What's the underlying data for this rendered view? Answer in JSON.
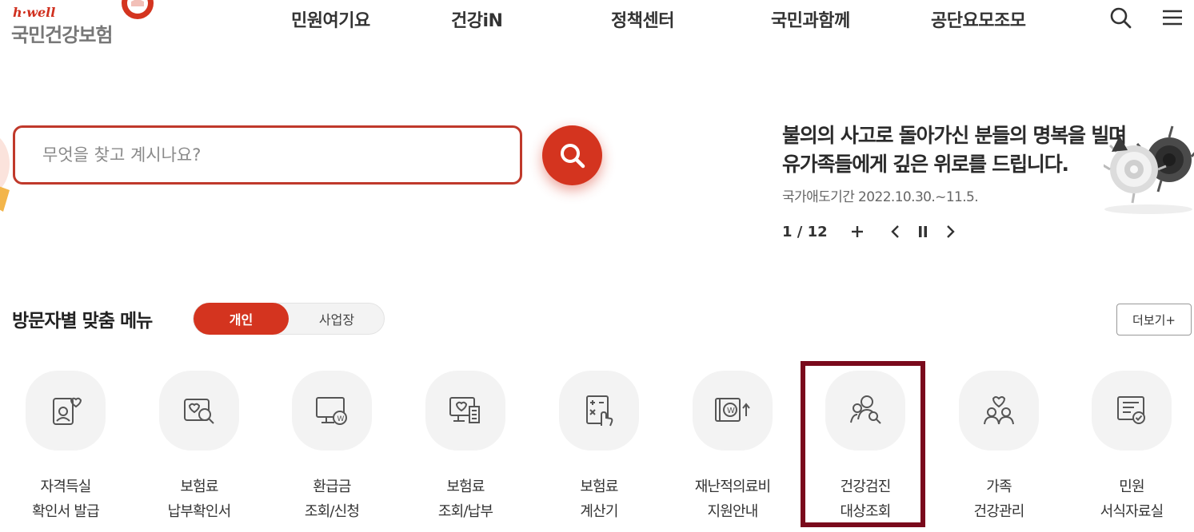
{
  "header": {
    "logo_brand": "h·well",
    "logo_name": "국민건강보험",
    "nav": [
      "민원여기요",
      "건강iN",
      "정책센터",
      "국민과함께",
      "공단요모조모"
    ]
  },
  "search": {
    "placeholder": "무엇을 찾고 계시나요?"
  },
  "notice": {
    "line1": "불의의 사고로 돌아가신 분들의 명복을 빌며",
    "line2": "유가족들에게 깊은 위로를 드립니다.",
    "sub": "국가애도기간 2022.10.30.~11.5.",
    "pager": "1 / 12"
  },
  "section": {
    "title": "방문자별 맞춤 메뉴",
    "tab_personal": "개인",
    "tab_business": "사업장",
    "more": "더보기+"
  },
  "menu": [
    {
      "line1": "자격득실",
      "line2": "확인서 발급",
      "icon": "id-card-heart-icon"
    },
    {
      "line1": "보험료",
      "line2": "납부확인서",
      "icon": "search-heart-icon"
    },
    {
      "line1": "환급금",
      "line2": "조회/신청",
      "icon": "monitor-won-icon"
    },
    {
      "line1": "보험료",
      "line2": "조회/납부",
      "icon": "monitor-receipt-icon"
    },
    {
      "line1": "보험료",
      "line2": "계산기",
      "icon": "calculator-icon"
    },
    {
      "line1": "재난적의료비",
      "line2": "지원안내",
      "icon": "won-support-icon"
    },
    {
      "line1": "건강검진",
      "line2": "대상조회",
      "icon": "people-search-icon"
    },
    {
      "line1": "가족",
      "line2": "건강관리",
      "icon": "family-heart-icon"
    },
    {
      "line1": "민원",
      "line2": "서식자료실",
      "icon": "document-check-icon"
    }
  ],
  "colors": {
    "accent": "#d4341f",
    "highlight": "#7a0a1c"
  }
}
